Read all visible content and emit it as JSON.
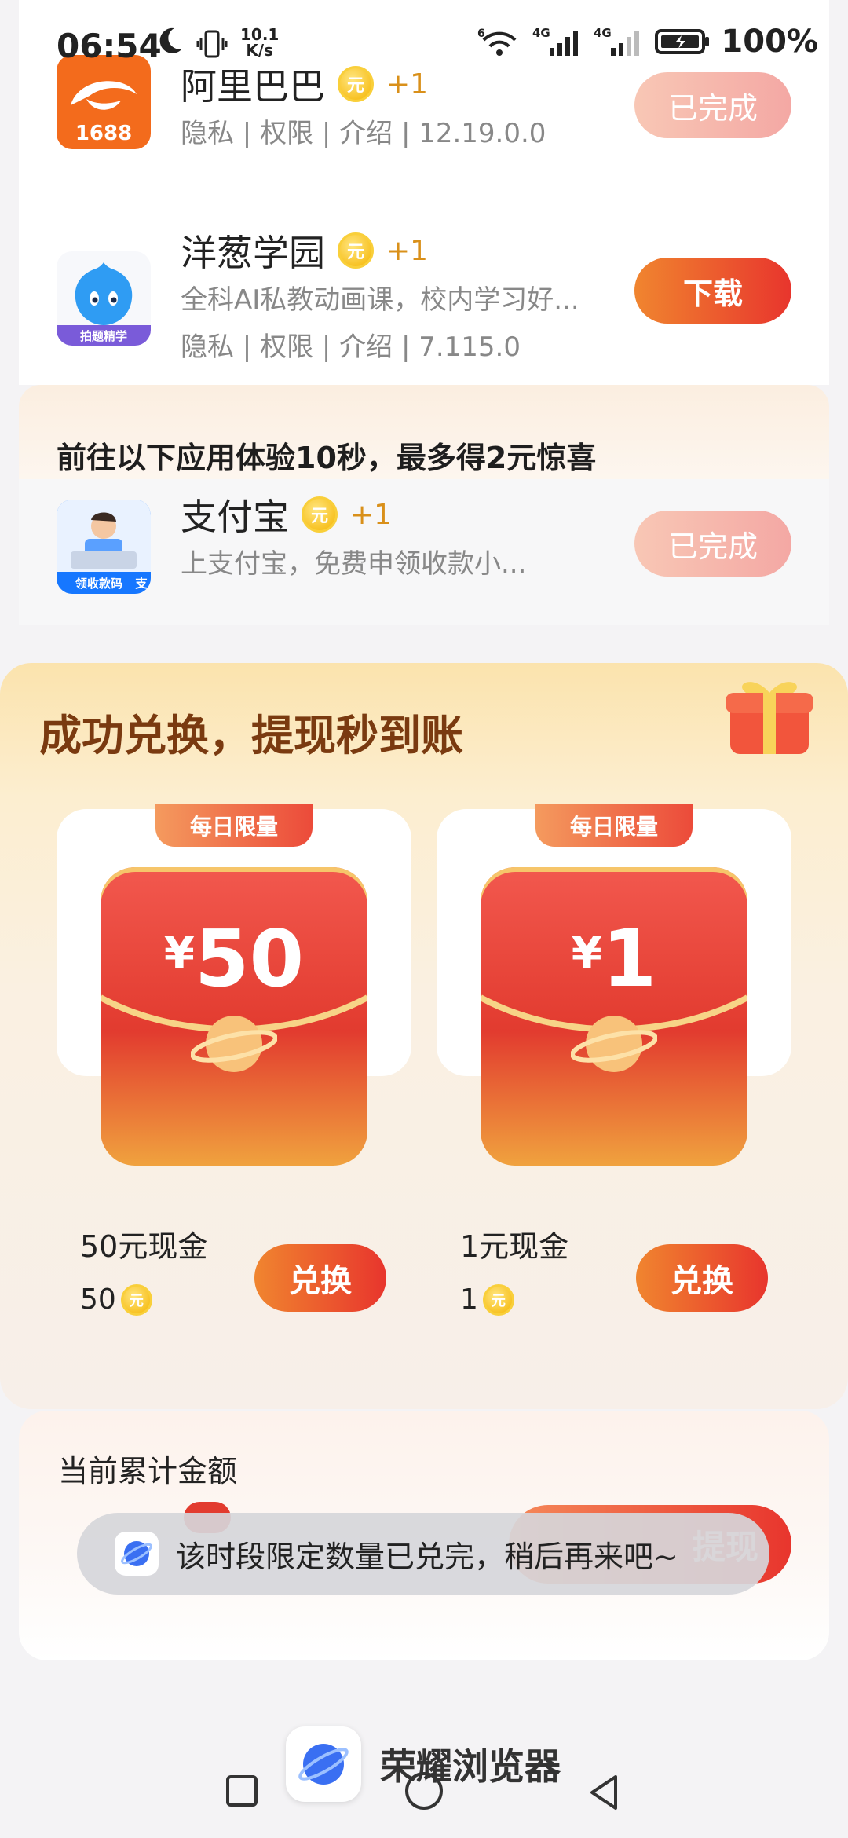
{
  "status_bar": {
    "time": "06:54",
    "speed_value": "10.1",
    "speed_unit": "K/s",
    "network": [
      "6",
      "4G",
      "4G"
    ],
    "battery": "100%"
  },
  "apps_top": [
    {
      "name": "阿里巴巴",
      "icon_label": "1688",
      "coin": "元",
      "reward": "+1",
      "meta": "隐私 | 权限 | 介绍 | 12.19.0.0",
      "button": "已完成"
    },
    {
      "name": "洋葱学园",
      "icon_label": "拍题精学",
      "coin": "元",
      "reward": "+1",
      "desc": "全科AI私教动画课，校内学习好...",
      "meta": "隐私 | 权限 | 介绍 | 7.115.0",
      "button": "下载"
    }
  ],
  "experience": {
    "title": "前往以下应用体验10秒，最多得2元惊喜",
    "app": {
      "name": "支付宝",
      "icon_label": "领收款码",
      "coin": "元",
      "reward": "+1",
      "desc": "上支付宝，免费申领收款小...",
      "button": "已完成"
    }
  },
  "exchange": {
    "title": "成功兑换，提现秒到账",
    "prizes": [
      {
        "badge": "每日限量",
        "currency": "¥",
        "amount": "50",
        "label": "50元现金",
        "cost": "50",
        "coin": "元",
        "button": "兑换"
      },
      {
        "badge": "每日限量",
        "currency": "¥",
        "amount": "1",
        "label": "1元现金",
        "cost": "1",
        "coin": "元",
        "button": "兑换"
      }
    ]
  },
  "total": {
    "title": "当前累计金额",
    "button": "提现"
  },
  "toast": {
    "text": "该时段限定数量已兑完，稍后再来吧~"
  },
  "bottom_app": {
    "name": "荣耀浏览器"
  },
  "colors": {
    "accent_orange": "#f0852f",
    "accent_red": "#e8352d",
    "exchange_title": "#7a3a10"
  }
}
